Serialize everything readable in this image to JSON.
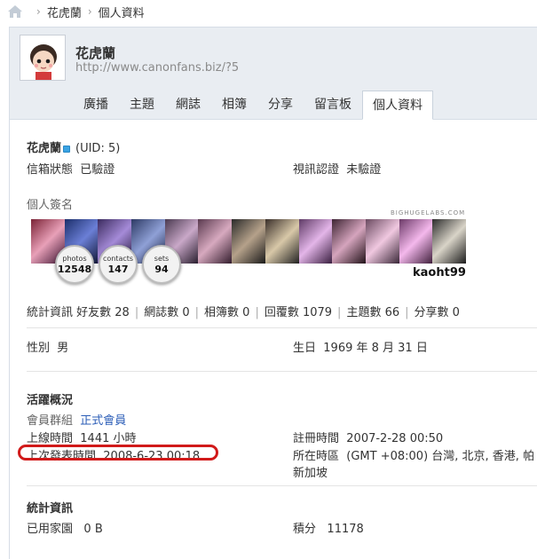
{
  "breadcrumb": {
    "items": [
      "花虎蘭",
      "個人資料"
    ]
  },
  "profile": {
    "name": "花虎蘭",
    "url": "http://www.canonfans.biz/?5"
  },
  "tabs": [
    {
      "label": "廣播"
    },
    {
      "label": "主題"
    },
    {
      "label": "網誌"
    },
    {
      "label": "相簿"
    },
    {
      "label": "分享"
    },
    {
      "label": "留言板"
    },
    {
      "label": "個人資料"
    }
  ],
  "info": {
    "username": "花虎蘭",
    "uid": "(UID: 5)",
    "email_label": "信箱狀態",
    "email_value": "已驗證",
    "video_label": "視訊認證",
    "video_value": "未驗證",
    "signature_label": "個人簽名"
  },
  "flickr_badge": {
    "brand": "BIGHUGELABS.COM",
    "user": "kaoht99",
    "photos_label": "photos",
    "photos_value": "12548",
    "contacts_label": "contacts",
    "contacts_value": "147",
    "sets_label": "sets",
    "sets_value": "94"
  },
  "stats": {
    "label": "統計資訊",
    "friends": "好友數 28",
    "blogs": "網誌數 0",
    "albums": "相簿數 0",
    "replies": "回覆數 1079",
    "topics": "主題數 66",
    "shares": "分享數 0"
  },
  "personal": {
    "gender_label": "性別",
    "gender_value": "男",
    "birthday_label": "生日",
    "birthday_value": "1969 年 8 月 31 日"
  },
  "activity": {
    "title": "活躍概況",
    "group_label": "會員群組",
    "group_value": "正式會員",
    "online_label": "上線時間",
    "online_value": "1441 小時",
    "register_label": "註冊時間",
    "register_value": "2007-2-28 00:50",
    "lastpost_label": "上次發表時間",
    "lastpost_value": "2008-6-23 00:18",
    "timezone_label": "所在時區",
    "timezone_value": "(GMT +08:00) 台灣, 北京, 香港, 帕",
    "timezone_cont": "新加坡"
  },
  "statistics": {
    "title": "統計資訊",
    "space_label": "已用家園",
    "space_value": "0 B",
    "points_label": "積分",
    "points_value": "11178"
  },
  "colors": {
    "accent_link": "#2b5db7",
    "highlight": "#d11a1a",
    "header_bg": "#e9edf2"
  }
}
